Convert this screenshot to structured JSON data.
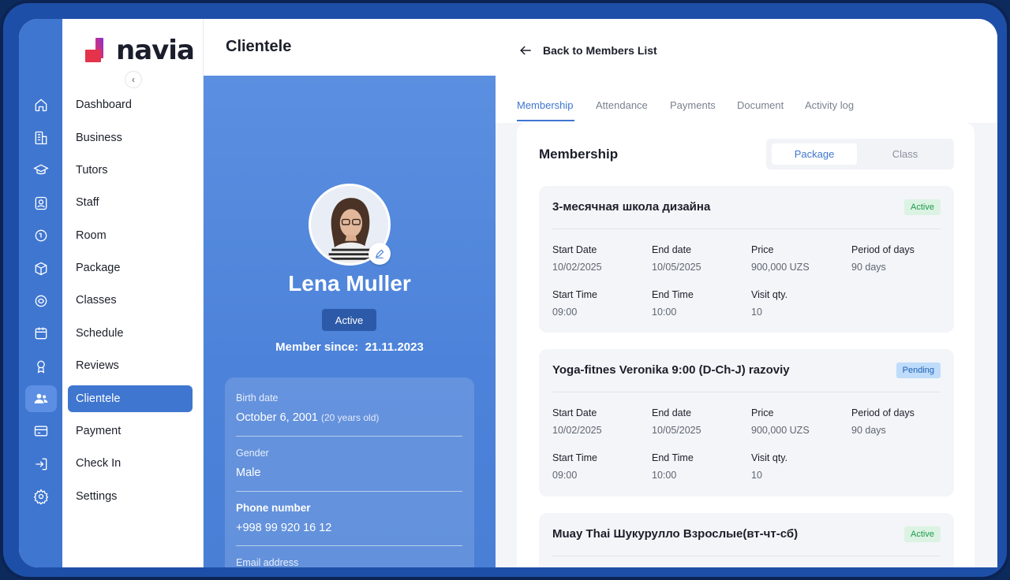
{
  "app": {
    "title": "Clientele",
    "logo_text": "navia",
    "brand_color": "#3f76d0"
  },
  "sidebar": {
    "items": [
      {
        "label": "Dashboard",
        "icon": "home-icon"
      },
      {
        "label": "Business",
        "icon": "building-icon"
      },
      {
        "label": "Tutors",
        "icon": "graduation-cap-icon"
      },
      {
        "label": "Staff",
        "icon": "user-badge-icon"
      },
      {
        "label": "Room",
        "icon": "door-icon"
      },
      {
        "label": "Package",
        "icon": "box-icon"
      },
      {
        "label": "Classes",
        "icon": "classes-icon"
      },
      {
        "label": "Schedule",
        "icon": "calendar-icon"
      },
      {
        "label": "Reviews",
        "icon": "award-icon"
      },
      {
        "label": "Clientele",
        "icon": "users-icon"
      },
      {
        "label": "Payment",
        "icon": "credit-card-icon"
      },
      {
        "label": "Check In",
        "icon": "check-in-icon"
      },
      {
        "label": "Settings",
        "icon": "gear-icon"
      }
    ],
    "active_index": 9
  },
  "profile": {
    "name": "Lena Muller",
    "status": "Active",
    "member_since_label": "Member since:",
    "member_since_value": "21.11.2023",
    "birth_label": "Birth date",
    "birth_value": "October 6, 2001",
    "birth_age": "(20 years old)",
    "gender_label": "Gender",
    "gender_value": "Male",
    "phone_label": "Phone number",
    "phone_value": "+998 99 920 16 12",
    "email_label": "Email address"
  },
  "back_link": "Back to Members List",
  "tabs": [
    "Membership",
    "Attendance",
    "Payments",
    "Document",
    "Activity log"
  ],
  "membership": {
    "title": "Membership",
    "segments": [
      "Package",
      "Class"
    ],
    "field_labels": {
      "start_date": "Start Date",
      "end_date": "End date",
      "price": "Price",
      "period": "Period of days",
      "start_time": "Start Time",
      "end_time": "End Time",
      "visit_qty": "Visit qty."
    },
    "cards": [
      {
        "title": "3-месячная школа дизайна",
        "status": "Active",
        "start_date": "10/02/2025",
        "end_date": "10/05/2025",
        "price": "900,000 UZS",
        "period": "90 days",
        "start_time": "09:00",
        "end_time": "10:00",
        "visit_qty": "10"
      },
      {
        "title": "Yoga-fitnes Veronika 9:00 (D-Ch-J) razoviy",
        "status": "Pending",
        "start_date": "10/02/2025",
        "end_date": "10/05/2025",
        "price": "900,000 UZS",
        "period": "90 days",
        "start_time": "09:00",
        "end_time": "10:00",
        "visit_qty": "10"
      },
      {
        "title": "Muay Thai Шукурулло Взрослые(вт-чт-сб)",
        "status": "Active"
      }
    ]
  }
}
